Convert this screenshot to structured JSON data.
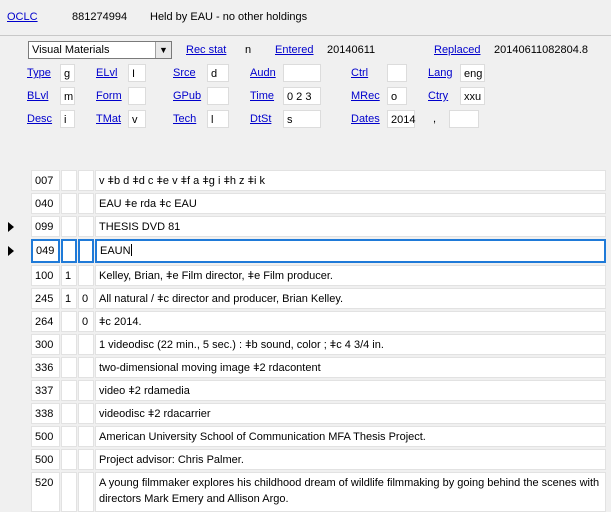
{
  "header": {
    "oclc_label": "OCLC",
    "oclc_number": "881274994",
    "holdings_text": "Held by EAU - no other holdings"
  },
  "fixed": {
    "type_select": "Visual Materials",
    "rec_stat_label": "Rec stat",
    "rec_stat": "n",
    "entered_label": "Entered",
    "entered": "20140611",
    "replaced_label": "Replaced",
    "replaced": "20140611082804.8",
    "row1": [
      {
        "label": "Type",
        "value": "g"
      },
      {
        "label": "ELvl",
        "value": "I"
      },
      {
        "label": "Srce",
        "value": "d"
      },
      {
        "label": "Audn",
        "value": ""
      },
      {
        "label": "Ctrl",
        "value": ""
      },
      {
        "label": "Lang",
        "value": "eng"
      }
    ],
    "row2": [
      {
        "label": "BLvl",
        "value": "m"
      },
      {
        "label": "Form",
        "value": ""
      },
      {
        "label": "GPub",
        "value": ""
      },
      {
        "label": "Time",
        "value": "0 2 3"
      },
      {
        "label": "MRec",
        "value": "o"
      },
      {
        "label": "Ctry",
        "value": "xxu"
      }
    ],
    "row3": [
      {
        "label": "Desc",
        "value": "i"
      },
      {
        "label": "TMat",
        "value": "v"
      },
      {
        "label": "Tech",
        "value": "l"
      },
      {
        "label": "DtSt",
        "value": "s"
      },
      {
        "label": "Dates",
        "value": "2014"
      },
      {
        "label": "dates_sep",
        "value": ","
      }
    ]
  },
  "fields": [
    {
      "tag": "007",
      "i1": "",
      "i2": "",
      "data": "v ǂb d ǂd c ǂe v ǂf a ǂg i ǂh z ǂi k",
      "marker": false
    },
    {
      "tag": "040",
      "i1": "",
      "i2": "",
      "data": "EAU ǂe rda ǂc EAU",
      "marker": false
    },
    {
      "tag": "099",
      "i1": "",
      "i2": "",
      "data": "THESIS DVD 81",
      "marker": true
    },
    {
      "tag": "049",
      "i1": "",
      "i2": "",
      "data": "EAUN",
      "marker": true,
      "selected": true
    },
    {
      "tag": "100",
      "i1": "1",
      "i2": "",
      "data": "Kelley, Brian, ǂe Film director, ǂe Film producer.",
      "marker": false
    },
    {
      "tag": "245",
      "i1": "1",
      "i2": "0",
      "data": "All natural / ǂc director and producer, Brian Kelley.",
      "marker": false
    },
    {
      "tag": "264",
      "i1": "",
      "i2": "0",
      "data": "ǂc 2014.",
      "marker": false
    },
    {
      "tag": "300",
      "i1": "",
      "i2": "",
      "data": "1 videodisc (22 min., 5 sec.) : ǂb sound, color ; ǂc 4 3/4 in.",
      "marker": false
    },
    {
      "tag": "336",
      "i1": "",
      "i2": "",
      "data": "two-dimensional moving image ǂ2 rdacontent",
      "marker": false
    },
    {
      "tag": "337",
      "i1": "",
      "i2": "",
      "data": "video ǂ2 rdamedia",
      "marker": false
    },
    {
      "tag": "338",
      "i1": "",
      "i2": "",
      "data": "videodisc ǂ2 rdacarrier",
      "marker": false
    },
    {
      "tag": "500",
      "i1": "",
      "i2": "",
      "data": "American University School of Communication MFA Thesis Project.",
      "marker": false
    },
    {
      "tag": "500",
      "i1": "",
      "i2": "",
      "data": "Project advisor: Chris Palmer.",
      "marker": false
    },
    {
      "tag": "520",
      "i1": "",
      "i2": "",
      "data": "A young filmmaker explores his childhood dream of wildlife filmmaking by going behind the scenes with directors Mark Emery and Allison Argo.",
      "marker": false
    }
  ]
}
